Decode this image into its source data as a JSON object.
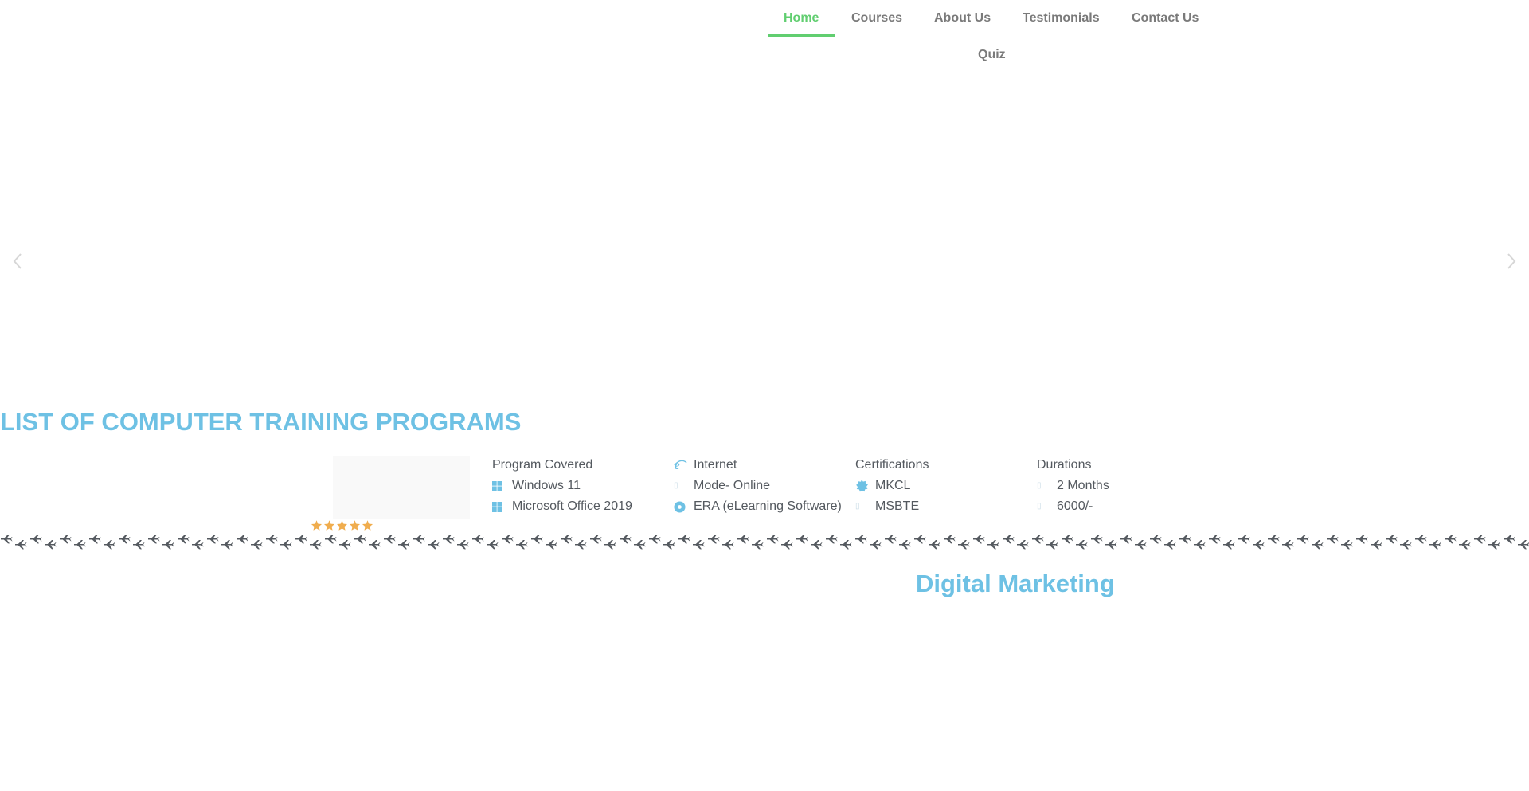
{
  "nav": {
    "items": [
      {
        "label": "Home",
        "active": true
      },
      {
        "label": "Courses",
        "active": false
      },
      {
        "label": "About Us",
        "active": false
      },
      {
        "label": "Testimonials",
        "active": false
      },
      {
        "label": "Contact Us",
        "active": false
      },
      {
        "label": "Quiz",
        "active": false
      }
    ],
    "active_color": "#61ce70",
    "text_color": "#7a7a7a"
  },
  "slider": {
    "prev_icon": "chevron-left-icon",
    "next_icon": "chevron-right-icon"
  },
  "section": {
    "title": "LIST OF COMPUTER TRAINING PROGRAMS",
    "title_color": "#6ec1e4"
  },
  "course": {
    "rating_stars": 5,
    "star_color": "#f0ad4e",
    "columns": [
      {
        "header": "Program Covered",
        "header_icon": "",
        "items": [
          {
            "icon": "windows-icon",
            "text": "Windows 11"
          },
          {
            "icon": "windows-icon",
            "text": "Microsoft Office 2019"
          }
        ]
      },
      {
        "header": "Internet",
        "header_icon": "internet-explorer-icon",
        "items": [
          {
            "icon": "placeholder-icon",
            "text": "Mode- Online"
          },
          {
            "icon": "disc-icon",
            "text": "ERA (eLearning Software)"
          }
        ]
      },
      {
        "header": "Certifications",
        "header_icon": "",
        "items": [
          {
            "icon": "certificate-icon",
            "text": "MKCL"
          },
          {
            "icon": "placeholder-icon",
            "text": "MSBTE"
          }
        ]
      },
      {
        "header": "Durations",
        "header_icon": "",
        "items": [
          {
            "icon": "placeholder-icon",
            "text": "2 Months"
          },
          {
            "icon": "placeholder-icon",
            "text": "6000/-"
          }
        ]
      }
    ]
  },
  "divider": {
    "icon": "plane-icon",
    "color": "#54595f"
  },
  "featured": {
    "title": "Digital Marketing"
  }
}
